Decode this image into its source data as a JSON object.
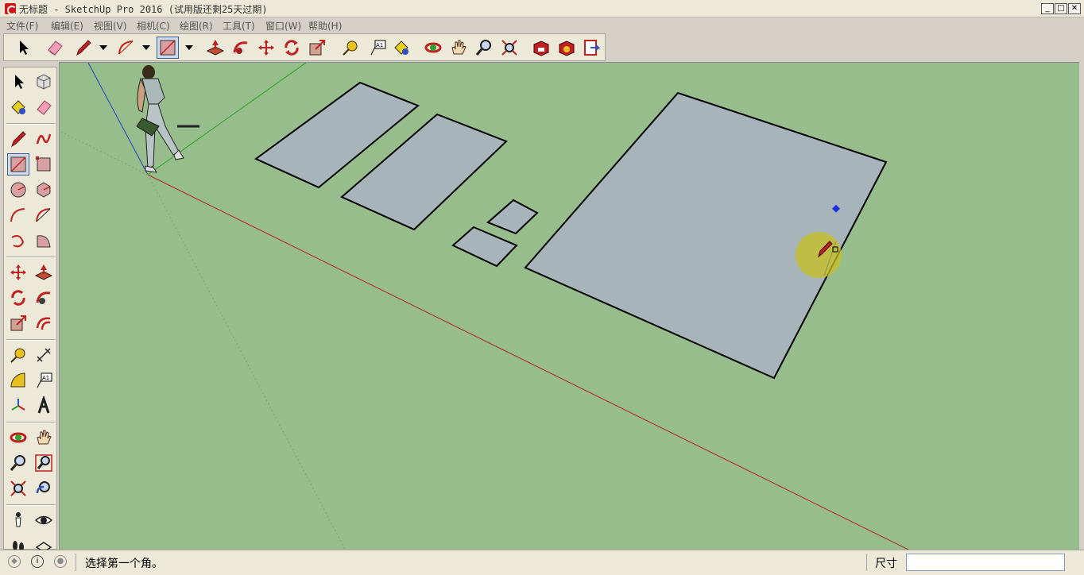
{
  "window": {
    "title": "无标题 - SketchUp Pro 2016 (试用版还剩25天过期)",
    "buttons": {
      "minimize": "_",
      "maximize": "□",
      "close": "✕"
    }
  },
  "menu": [
    "文件(F)",
    "编辑(E)",
    "视图(V)",
    "相机(C)",
    "绘图(R)",
    "工具(T)",
    "窗口(W)",
    "帮助(H)"
  ],
  "toolbar": {
    "tools": [
      "select",
      "eraser",
      "pencil-line",
      "arc",
      "rectangle",
      "push-pull",
      "follow-me",
      "move",
      "rotate",
      "scale",
      "tape-measure",
      "text",
      "paint-bucket",
      "orbit",
      "pan",
      "zoom",
      "zoom-extents",
      "3d-warehouse",
      "extension-warehouse",
      "send-to-layout"
    ],
    "active": "rectangle"
  },
  "sidebar": {
    "tools": [
      "select",
      "make-component",
      "paint-bucket",
      "eraser",
      "line",
      "freehand",
      "rectangle",
      "rotated-rectangle",
      "circle",
      "polygon",
      "arc",
      "two-point-arc",
      "three-point-arc",
      "pie",
      "move",
      "push-pull",
      "rotate",
      "follow-me",
      "scale",
      "offset",
      "tape-measure",
      "dimension",
      "protractor",
      "text",
      "axes",
      "3d-text",
      "orbit",
      "pan",
      "zoom",
      "zoom-window",
      "zoom-extents",
      "previous",
      "position-camera",
      "look-around",
      "walk",
      "section-plane"
    ],
    "active": "rectangle"
  },
  "viewport": {
    "background": "#98bd8c",
    "face_color": "#a7b5bb",
    "axis_colors": {
      "red": "#b02020",
      "green": "#20a020",
      "blue": "#2040c0"
    },
    "cursor": "pencil-rectangle-cursor"
  },
  "statusbar": {
    "message": "选择第一个角。",
    "measurement_label": "尺寸",
    "measurement_value": ""
  }
}
